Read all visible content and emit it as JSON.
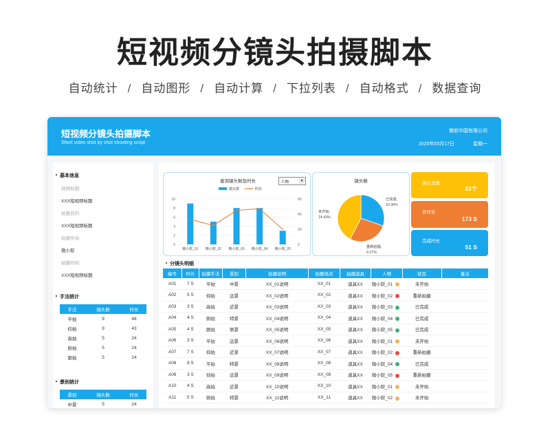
{
  "hero": {
    "title": "短视频分镜头拍摄脚本",
    "features": [
      "自动统计",
      "自动图形",
      "自动计算",
      "下拉列表",
      "自动格式",
      "数据查询"
    ]
  },
  "banner": {
    "title": "短视频分镜头拍摄脚本",
    "subtitle": "Short video shot by shot shooting script",
    "company": "微软中国有限公司",
    "date": "2025年03月17日",
    "weekday": "星期一"
  },
  "sidebar": {
    "basic_title": "基本信息",
    "fields": [
      {
        "label": "视频标题:",
        "value": "XXX短视频标题"
      },
      {
        "label": "拍摄目的:",
        "value": "XXX短视频标题"
      },
      {
        "label": "拍摄导演:",
        "value": "微小软"
      },
      {
        "label": "拍摄时间:",
        "value": "XXX短视频标题"
      }
    ],
    "technique_title": "手法统计",
    "technique_headers": [
      "手法",
      "镜头数",
      "时长"
    ],
    "technique_rows": [
      [
        "平拍",
        "9",
        "48"
      ],
      [
        "仰拍",
        "9",
        "43"
      ],
      [
        "高拍",
        "5",
        "24"
      ],
      [
        "俯拍",
        "5",
        "24"
      ],
      [
        "跟拍",
        "5",
        "24"
      ]
    ],
    "scene_title": "景别统计",
    "scene_headers": [
      "景别",
      "镜头数",
      "时长"
    ],
    "scene_rows": [
      [
        "中景",
        "5",
        "24"
      ]
    ]
  },
  "combo": {
    "title": "查询镜头数及时长",
    "dropdown": "人物",
    "legend_bar": "镜头数",
    "legend_line": "时长"
  },
  "pie": {
    "title": "镜头数"
  },
  "kpi": {
    "total_label": "镜头总数",
    "total_value": "33个",
    "duration_label": "总时长",
    "duration_value": "173 S",
    "done_label": "完成时长",
    "done_value": "51 S",
    "colors": [
      "#ffc107",
      "#ef7d32",
      "#1aa7ec"
    ]
  },
  "detail": {
    "title": "分镜头明细",
    "headers": [
      "编号",
      "时长",
      "拍摄手法",
      "景别",
      "拍摄说明",
      "拍摄场点",
      "拍摄道具",
      "人物",
      "状态",
      "备注"
    ],
    "rows": [
      [
        "A01",
        "7 S",
        "平拍",
        "中景",
        "XX_01说明",
        "XX_01",
        "道具XX",
        "微小软_01",
        "未开始",
        ""
      ],
      [
        "A02",
        "5 S",
        "仰拍",
        "远景",
        "XX_02说明",
        "XX_02",
        "道具XX",
        "微小软_02",
        "重新拍摄",
        ""
      ],
      [
        "A03",
        "3 S",
        "高拍",
        "近景",
        "XX_03说明",
        "XX_03",
        "道具XX",
        "微小软_03",
        "已完成",
        ""
      ],
      [
        "A04",
        "4 S",
        "俯拍",
        "特景",
        "XX_04说明",
        "XX_04",
        "道具XX",
        "微小软_04",
        "已完成",
        ""
      ],
      [
        "A05",
        "4 S",
        "跟拍",
        "侧景",
        "XX_05说明",
        "XX_05",
        "道具XX",
        "微小软_05",
        "已完成",
        ""
      ],
      [
        "A06",
        "3 S",
        "平拍",
        "远景",
        "XX_06说明",
        "XX_06",
        "道具XX",
        "微小软_01",
        "未开始",
        ""
      ],
      [
        "A07",
        "7 S",
        "仰拍",
        "近景",
        "XX_07说明",
        "XX_07",
        "道具XX",
        "微小软_02",
        "重新拍摄",
        ""
      ],
      [
        "A08",
        "8 S",
        "平拍",
        "特景",
        "XX_08说明",
        "XX_08",
        "道具XX",
        "微小软_04",
        "已完成",
        ""
      ],
      [
        "A09",
        "3 S",
        "仰拍",
        "远景",
        "XX_09说明",
        "XX_09",
        "道具XX",
        "微小软_05",
        "重新拍摄",
        ""
      ],
      [
        "A10",
        "4 S",
        "高拍",
        "近景",
        "XX_10说明",
        "XX_10",
        "道具XX",
        "微小软_01",
        "未开始",
        ""
      ],
      [
        "A11",
        "5 S",
        "俯拍",
        "特景",
        "XX_11说明",
        "XX_11",
        "道具XX",
        "微小软_02",
        "未开始",
        ""
      ]
    ],
    "status_colors": {
      "未开始": "#f0b35a",
      "重新拍摄": "#e54d3f",
      "已完成": "#3cb371"
    }
  },
  "chart_data": [
    {
      "type": "bar",
      "title": "查询镜头数及时长",
      "categories": [
        "微小软_01",
        "微小软_02",
        "微小软_03",
        "微小软_04",
        "微小软_05"
      ],
      "series": [
        {
          "name": "镜头数",
          "type": "bar",
          "axis": "left",
          "values": [
            9,
            5,
            8,
            8,
            3
          ]
        },
        {
          "name": "时长",
          "type": "line",
          "axis": "right",
          "values": [
            33,
            25,
            45,
            47,
            20
          ]
        }
      ],
      "ylim": [
        0,
        10
      ],
      "y_ticks": [
        "0",
        "2",
        "4",
        "6",
        "8",
        "10"
      ],
      "y2lim": [
        0,
        60
      ],
      "y2_ticks": [
        "0",
        "20",
        "40",
        "60"
      ],
      "colors": [
        "#1aa7ec",
        "#ef7d32"
      ],
      "legend": "top"
    },
    {
      "type": "pie",
      "title": "镜头数",
      "labels": [
        "已完成",
        "重新拍摄",
        "未开始"
      ],
      "values": [
        10.3,
        9.27,
        14.43
      ],
      "display": [
        "已完成, 10.30%",
        "重新拍摄, 9.27%",
        "未开始, 14.43%"
      ],
      "colors": [
        "#1aa7ec",
        "#ef7d32",
        "#ffc107"
      ]
    }
  ]
}
